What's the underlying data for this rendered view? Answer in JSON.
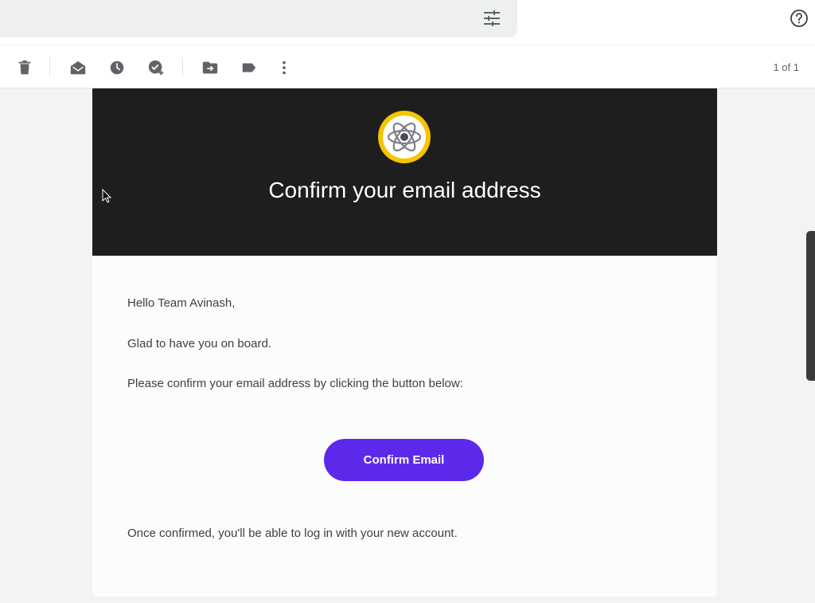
{
  "toolbar": {
    "icons": [
      "delete-icon",
      "mark-read-icon",
      "snooze-icon",
      "add-task-icon",
      "move-to-icon",
      "label-icon",
      "more-options-icon"
    ],
    "pager": "1 of 1"
  },
  "topbar": {
    "icons": [
      "filter-options-icon",
      "help-icon"
    ]
  },
  "email": {
    "title": "Confirm your email address",
    "greeting": "Hello Team Avinash,",
    "welcome": "Glad to have you on board.",
    "instruction": "Please confirm your email address by clicking the button below:",
    "button_label": "Confirm Email",
    "footer": "Once confirmed, you'll be able to log in with your new account."
  },
  "colors": {
    "hero_bg": "#1e1e1e",
    "button": "#5c29eb",
    "logo_ring": "#f6c400"
  }
}
